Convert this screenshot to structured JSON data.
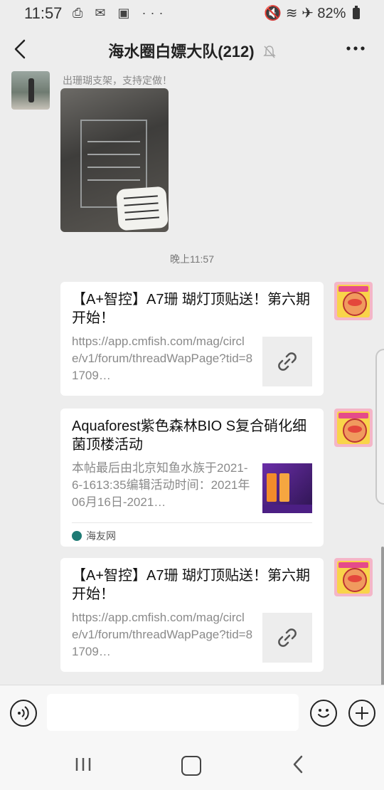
{
  "status_bar": {
    "time": "11:57",
    "left_icons": "⎙ ✉ ▣ ···",
    "right_icons": "🔇 ≋ ✈",
    "battery": "82%"
  },
  "header": {
    "title": "海水圈白嫖大队(212)",
    "back_icon": "chevron-left-icon",
    "mute_icon": "bell-off-icon",
    "more_icon": "more-dots-icon"
  },
  "messages": {
    "sender_name": "出珊瑚支架，支持定做！",
    "time_separator": "晚上11:57",
    "card1": {
      "title": "【A+智控】A7珊 瑚灯顶贴送！第六期开始！",
      "desc": "https://app.cmfish.com/mag/circle/v1/forum/threadWapPage?tid=81709…"
    },
    "card2": {
      "title": "Aquaforest紫色森林BIO S复合硝化细菌顶楼活动",
      "desc": "本帖最后由北京知鱼水族于2021-6-1613:35编辑活动时间：2021年06月16日-2021…",
      "source": "海友网"
    },
    "card3": {
      "title": "【A+智控】A7珊 瑚灯顶贴送！第六期开始！",
      "desc": "https://app.cmfish.com/mag/circle/v1/forum/threadWapPage?tid=81709…"
    }
  },
  "input_bar": {
    "placeholder": "",
    "voice_icon": "voice-icon",
    "emoji_icon": "emoji-icon",
    "plus_icon": "plus-icon"
  },
  "nav_bar": {
    "recent_icon": "recent-apps-icon",
    "home_icon": "home-icon",
    "back_icon": "back-icon"
  }
}
